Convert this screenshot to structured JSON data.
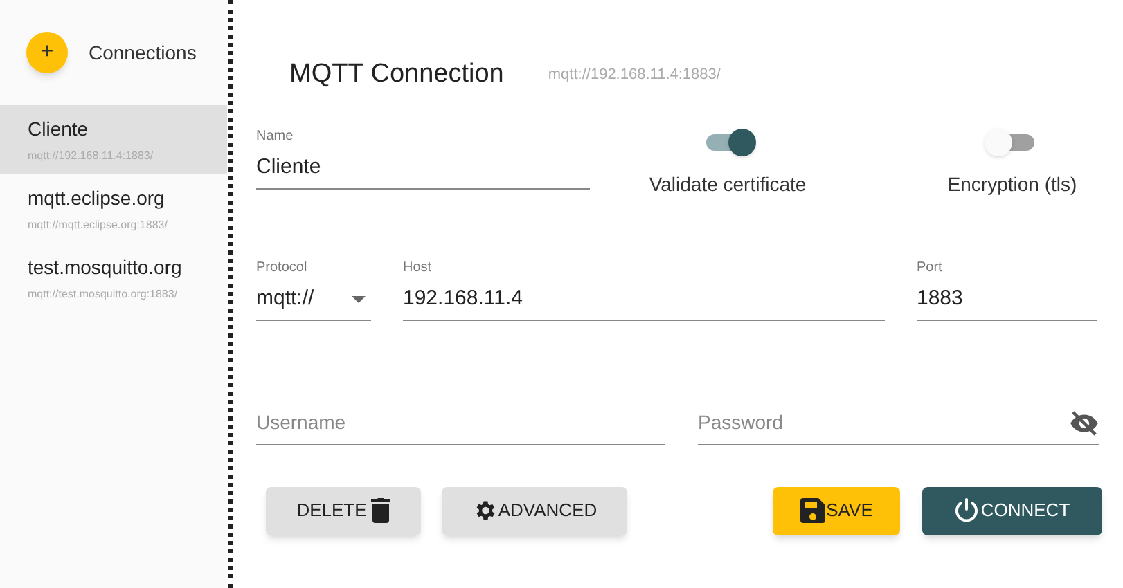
{
  "sidebar": {
    "add_button": "+",
    "title": "Connections",
    "connections": [
      {
        "name": "Cliente",
        "url": "mqtt://192.168.11.4:1883/",
        "selected": true
      },
      {
        "name": "mqtt.eclipse.org",
        "url": "mqtt://mqtt.eclipse.org:1883/",
        "selected": false
      },
      {
        "name": "test.mosquitto.org",
        "url": "mqtt://test.mosquitto.org:1883/",
        "selected": false
      }
    ]
  },
  "main": {
    "title": "MQTT Connection",
    "url": "mqtt://192.168.11.4:1883/",
    "name_field": {
      "label": "Name",
      "value": "Cliente"
    },
    "toggles": [
      {
        "label": "Validate certificate",
        "on": true
      },
      {
        "label": "Encryption (tls)",
        "on": false
      }
    ],
    "protocol_field": {
      "label": "Protocol",
      "value": "mqtt://"
    },
    "host_field": {
      "label": "Host",
      "value": "192.168.11.4"
    },
    "port_field": {
      "label": "Port",
      "value": "1883"
    },
    "username_field": {
      "placeholder": "Username"
    },
    "password_field": {
      "placeholder": "Password"
    },
    "buttons": [
      {
        "kind": "delete",
        "label": "DELETE"
      },
      {
        "kind": "advanced",
        "label": "ADVANCED"
      },
      {
        "kind": "save",
        "label": "SAVE"
      },
      {
        "kind": "connect",
        "label": "CONNECT"
      }
    ]
  }
}
